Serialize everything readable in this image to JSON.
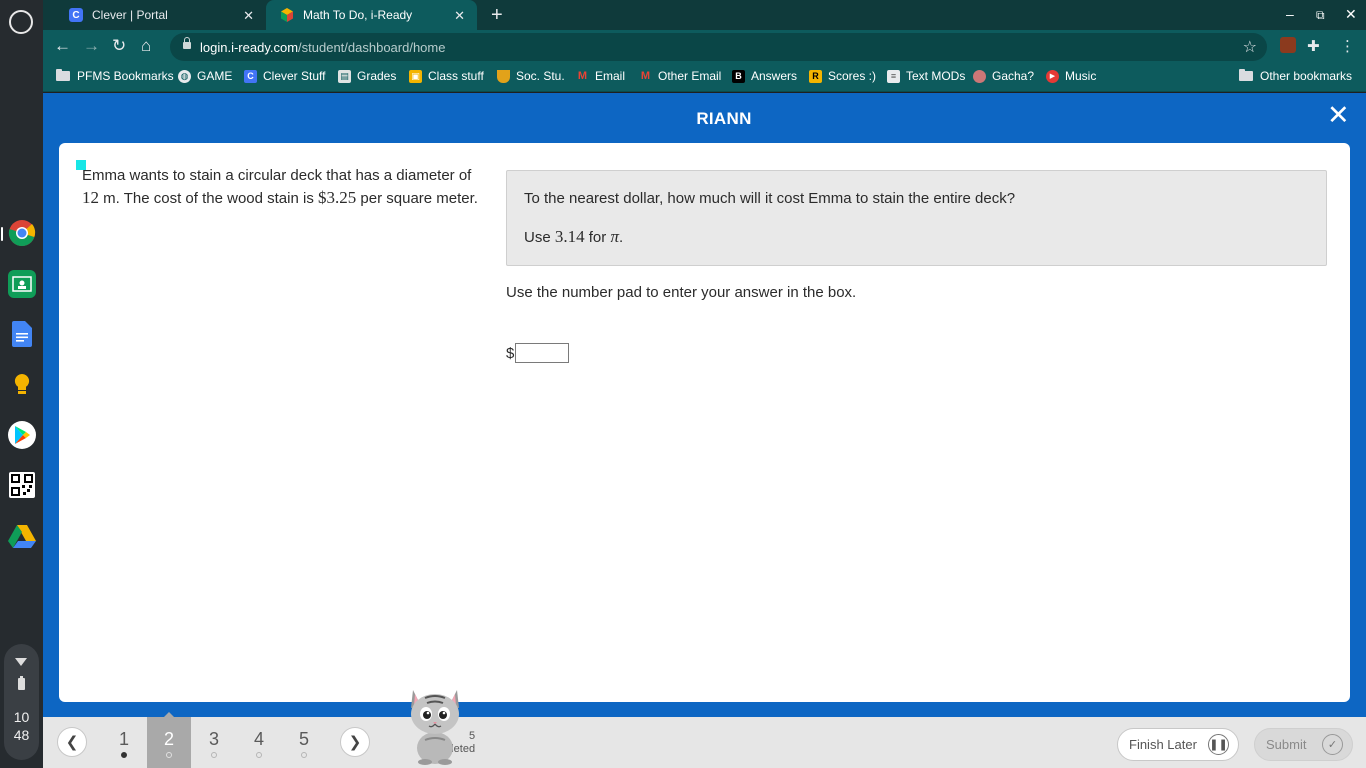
{
  "shelf": {
    "apps": [
      "chrome-icon",
      "google-classroom-icon",
      "google-docs-icon",
      "google-keep-icon",
      "google-play-icon",
      "qr-code-icon",
      "google-drive-icon"
    ],
    "clock_hour": "10",
    "clock_minute": "48"
  },
  "browser": {
    "tabs": [
      {
        "title": "Clever | Portal",
        "active": false
      },
      {
        "title": "Math To Do, i-Ready",
        "active": true
      }
    ],
    "url_domain": "login.i-ready.com",
    "url_path": "/student/dashboard/home",
    "bookmarks": [
      {
        "label": "PFMS Bookmarks",
        "icon": "folder-icon"
      },
      {
        "label": "GAME",
        "icon": "globe-icon"
      },
      {
        "label": "Clever Stuff",
        "icon": "clever-icon"
      },
      {
        "label": "Grades",
        "icon": "grades-icon"
      },
      {
        "label": "Class stuff",
        "icon": "classroom-icon"
      },
      {
        "label": "Soc. Stu.",
        "icon": "shield-icon"
      },
      {
        "label": "Email",
        "icon": "gmail-icon"
      },
      {
        "label": "Other Email",
        "icon": "gmail-icon"
      },
      {
        "label": "Answers",
        "icon": "brainly-icon"
      },
      {
        "label": "Scores :)",
        "icon": "r-icon"
      },
      {
        "label": "Text MODs",
        "icon": "doc-icon"
      },
      {
        "label": "Gacha?",
        "icon": "gacha-icon"
      },
      {
        "label": "Music",
        "icon": "youtube-music-icon"
      }
    ],
    "other_bookmarks": "Other bookmarks"
  },
  "lesson": {
    "student_name": "RIANN",
    "prompt": {
      "p1": "Emma wants to stain a circular deck that has a diameter of ",
      "diameter": "12",
      "p2": " m. The cost of the wood stain is ",
      "cost": "$3.25",
      "p3": " per square meter."
    },
    "question": {
      "line1": "To the nearest dollar, how much will it cost Emma to stain the entire deck?",
      "use": "Use ",
      "pi_value": "3.14",
      "for": " for ",
      "pi_symbol": "π",
      "period": "."
    },
    "instruction": "Use the number pad to enter your answer in the box.",
    "answer": {
      "prefix": "$",
      "value": ""
    }
  },
  "footer": {
    "questions": [
      {
        "number": "1",
        "status": "answered"
      },
      {
        "number": "2",
        "status": "current"
      },
      {
        "number": "3",
        "status": "unanswered"
      },
      {
        "number": "4",
        "status": "unanswered"
      },
      {
        "number": "5",
        "status": "unanswered"
      }
    ],
    "progress_count": "5",
    "progress_label": "npleted",
    "finish_later": "Finish Later",
    "submit": "Submit"
  },
  "colors": {
    "browser_theme": "#0d5b5d",
    "iready_blue": "#0d66c3",
    "shelf": "#262b2f"
  }
}
